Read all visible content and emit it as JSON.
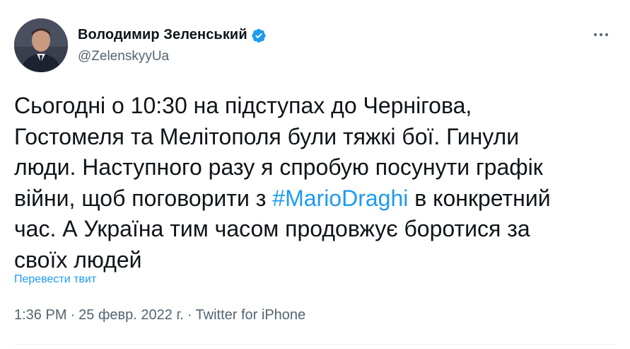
{
  "author": {
    "display_name": "Володимир Зеленський",
    "handle": "@ZelenskyyUa",
    "verified": true
  },
  "tweet": {
    "lines": [
      [
        "Сьогодні о 10:30 на підступах до Чернігова,"
      ],
      [
        "Гостомеля та Мелітополя були тяжкі бої. Гинули"
      ],
      [
        "люди. Наступного разу я спробую посунути графік"
      ],
      [
        "війни, щоб поговорити з ",
        "#MarioDraghi",
        " в конкретний"
      ],
      [
        "час. А Україна тим часом продовжує боротися за"
      ],
      [
        "своїх людей"
      ]
    ],
    "hashtag": "#MarioDraghi",
    "translate_label": "Перевести твит"
  },
  "meta": {
    "time": "1:36 PM",
    "date": "25 февр. 2022 г.",
    "source": "Twitter for iPhone",
    "separator": "·"
  },
  "colors": {
    "accent": "#1d9bf0",
    "text": "#0f1419",
    "secondary": "#536471"
  },
  "icons": {
    "verified": "verified-badge-icon",
    "more": "more-options-icon"
  }
}
